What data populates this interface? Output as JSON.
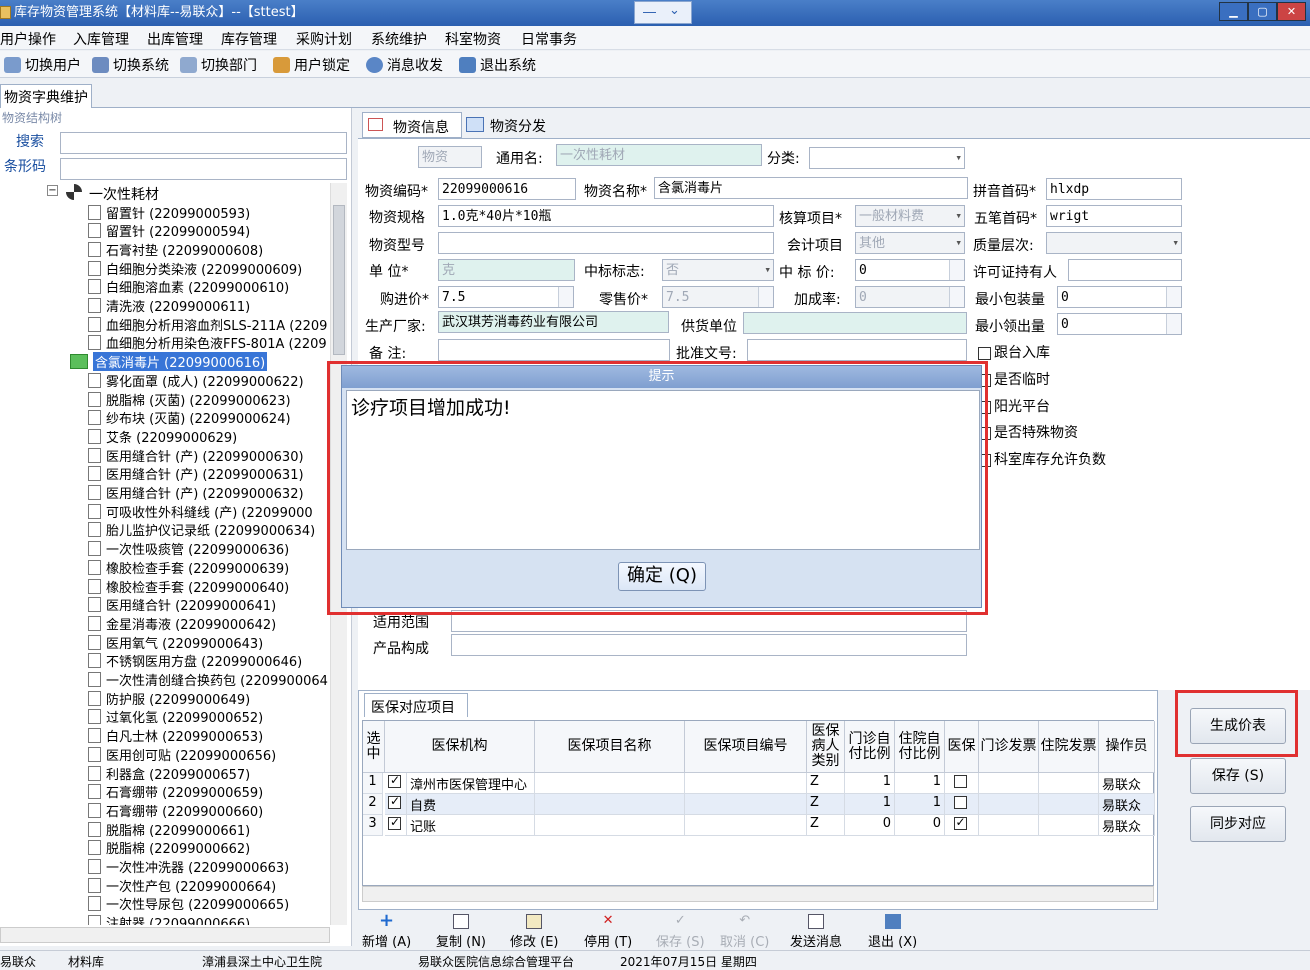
{
  "window": {
    "title": "库存物资管理系统【材料库--易联众】--【sttest】"
  },
  "menu": [
    "用户操作",
    "入库管理",
    "出库管理",
    "库存管理",
    "采购计划",
    "系统维护",
    "科室物资",
    "日常事务"
  ],
  "toolbar": [
    "切换用户",
    "切换系统",
    "切换部门",
    "用户锁定",
    "消息收发",
    "退出系统"
  ],
  "tab": "物资字典维护",
  "left": {
    "group": "物资结构树",
    "search_label": "搜索",
    "barcode_label": "条形码",
    "root": "一次性耗材",
    "items": [
      "留置针 (22099000593)",
      "留置针 (22099000594)",
      "石膏衬垫 (22099000608)",
      "白细胞分类染液 (22099000609)",
      "白细胞溶血素 (22099000610)",
      "清洗液 (22099000611)",
      "血细胞分析用溶血剂SLS-211A (2209",
      "血细胞分析用染色液FFS-801A (2209",
      "含氯消毒片 (22099000616)",
      "雾化面罩 (成人) (22099000622)",
      "脱脂棉 (灭菌) (22099000623)",
      "纱布块 (灭菌) (22099000624)",
      "艾条 (22099000629)",
      "医用缝合针 (产) (22099000630)",
      "医用缝合针 (产) (22099000631)",
      "医用缝合针 (产) (22099000632)",
      "可吸收性外科缝线 (产) (22099000",
      "胎儿监护仪记录纸 (22099000634)",
      "一次性吸痰管 (22099000636)",
      "橡胶检查手套 (22099000639)",
      "橡胶检查手套 (22099000640)",
      "医用缝合针 (22099000641)",
      "金星消毒液 (22099000642)",
      "医用氧气 (22099000643)",
      "不锈钢医用方盘 (22099000646)",
      "一次性清创缝合换药包 (2209900064",
      "防护服 (22099000649)",
      "过氧化氢 (22099000652)",
      "白凡士林 (22099000653)",
      "医用创可贴 (22099000656)",
      "利器盒 (22099000657)",
      "石膏绷带 (22099000659)",
      "石膏绷带 (22099000660)",
      "脱脂棉 (22099000661)",
      "脱脂棉 (22099000662)",
      "一次性冲洗器 (22099000663)",
      "一次性产包 (22099000664)",
      "一次性导尿包 (22099000665)",
      "注射器 (22099000666)"
    ]
  },
  "right_tabs": [
    "物资信息",
    "物资分发"
  ],
  "form": {
    "top_field": "物资",
    "generic_name_label": "通用名:",
    "generic_name": "一次性耗材",
    "category_label": "分类:",
    "code_label": "物资编码*",
    "code": "22099000616",
    "name_label": "物资名称*",
    "name": "含氯消毒片",
    "pinyin_label": "拼音首码*",
    "pinyin": "hlxdp",
    "spec_label": "物资规格",
    "spec": "1.0克*40片*10瓶",
    "acct_item_label": "核算项目*",
    "acct_item": "一般材料费",
    "wubi_label": "五笔首码*",
    "wubi": "wrigt",
    "model_label": "物资型号",
    "account_label": "会计项目",
    "account": "其他",
    "quality_label": "质量层次:",
    "unit_label": "单    位*",
    "unit": "克",
    "bid_flag_label": "中标标志:",
    "bid_flag": "否",
    "bid_price_label": "中 标 价:",
    "bid_price": "0",
    "license_label": "许可证持有人",
    "purchase_label": "购进价*",
    "purchase": "7.5",
    "retail_label": "零售价*",
    "retail": "7.5",
    "markup_label": "加成率:",
    "markup": "0",
    "min_pack_label": "最小包装量",
    "min_pack": "0",
    "maker_label": "生产厂家:",
    "maker": "武汉琪芳消毒药业有限公司",
    "supplier_label": "供货单位",
    "min_out_label": "最小领出量",
    "min_out": "0",
    "remark_label": "备    注:",
    "approval_label": "批准文号:",
    "checks": [
      "跟台入库",
      "是否临时",
      "阳光平台",
      "是否特殊物资",
      "科室库存允许负数"
    ],
    "scope_label": "适用范围",
    "composition_label": "产品构成"
  },
  "dialog": {
    "title": "提示",
    "message": "诊疗项目增加成功!",
    "ok": "确定 (Q)"
  },
  "grid": {
    "tab": "医保对应项目",
    "headers": [
      "选中",
      "医保机构",
      "医保项目名称",
      "医保项目编号",
      "医保病人类别",
      "门诊自付比例",
      "住院自付比例",
      "医保",
      "门诊发票",
      "住院发票",
      "操作员"
    ],
    "rows": [
      {
        "n": "1",
        "sel": true,
        "org": "漳州市医保管理中心",
        "cat": "Z",
        "op": "1",
        "ip": "1",
        "ins": false,
        "user": "易联众"
      },
      {
        "n": "2",
        "sel": true,
        "org": "自费",
        "cat": "Z",
        "op": "1",
        "ip": "1",
        "ins": false,
        "user": "易联众"
      },
      {
        "n": "3",
        "sel": true,
        "org": "记账",
        "cat": "Z",
        "op": "0",
        "ip": "0",
        "ins": true,
        "user": "易联众"
      }
    ]
  },
  "side_buttons": [
    "生成价表",
    "保存 (S)",
    "同步对应"
  ],
  "bottom": [
    "新增 (A)",
    "复制 (N)",
    "修改 (E)",
    "停用 (T)",
    "保存 (S)",
    "取消 (C)",
    "发送消息",
    "退出 (X)"
  ],
  "status": [
    "易联众",
    "材料库",
    "漳浦县深土中心卫生院",
    "易联众医院信息综合管理平台",
    "2021年07月15日 星期四"
  ]
}
